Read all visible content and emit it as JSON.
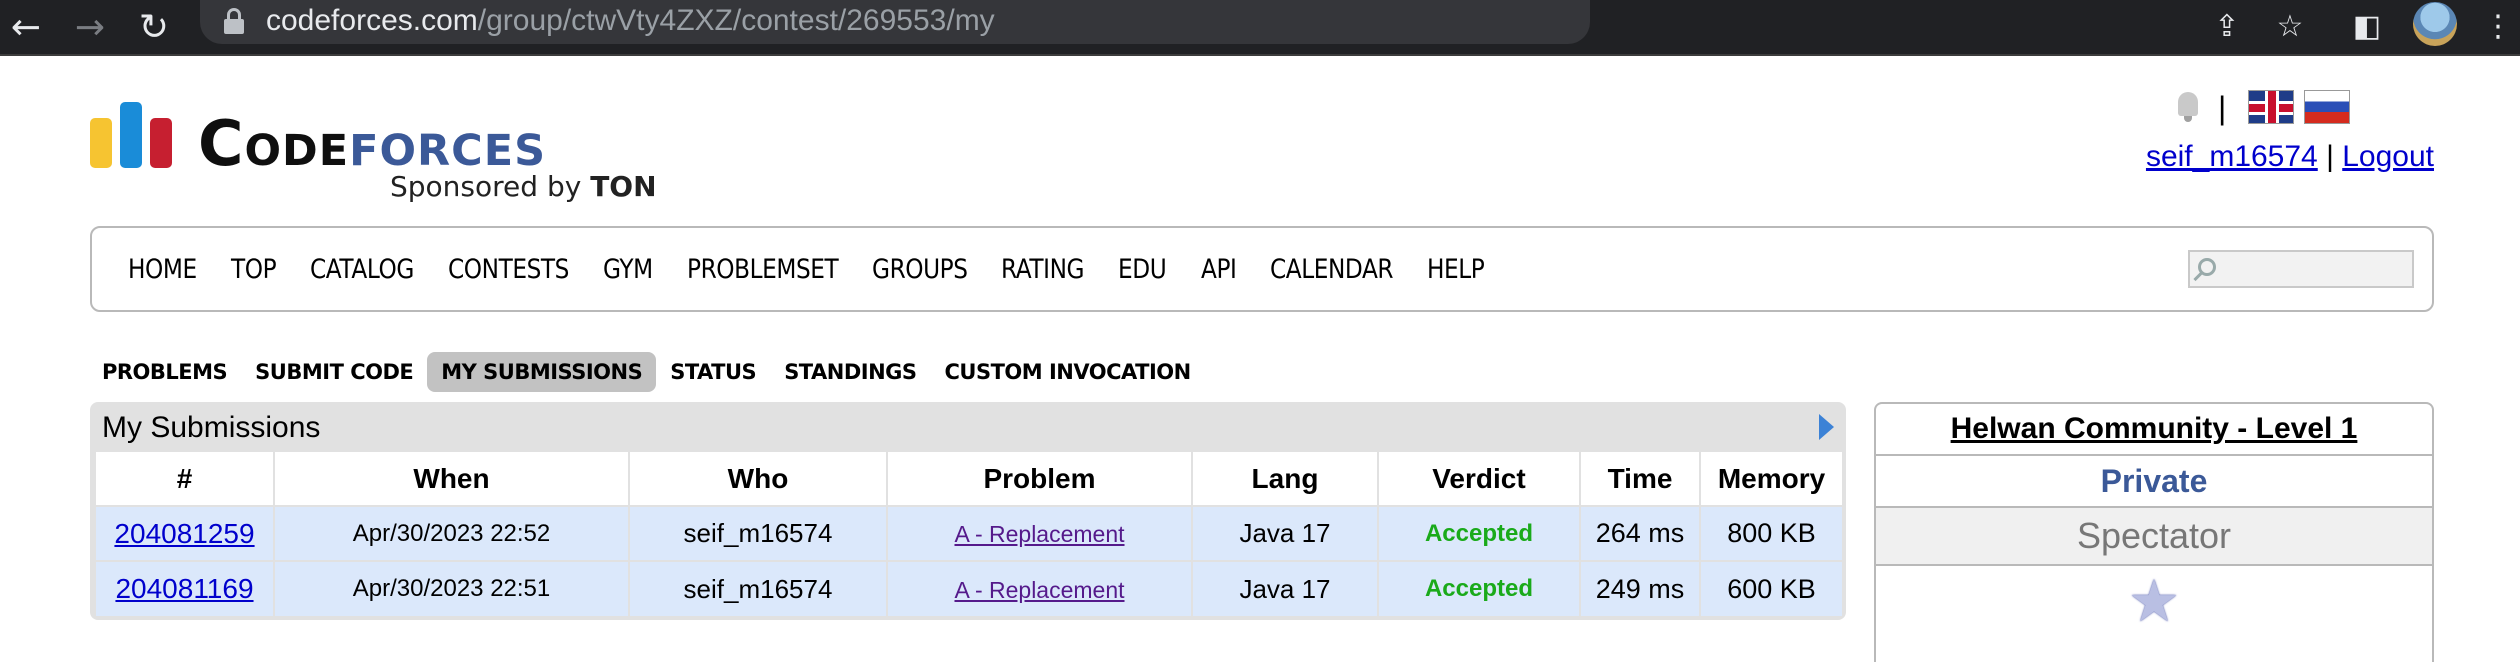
{
  "browser": {
    "url_domain": "codeforces.com",
    "url_path": "/group/ctwVty4ZXZ/contest/269553/my",
    "icons": [
      "back-arrow-icon",
      "forward-arrow-icon",
      "reload-icon",
      "lock-icon",
      "share-icon",
      "star-bookmark-icon",
      "side-panel-icon",
      "profile-avatar",
      "kebab-menu-icon"
    ]
  },
  "header": {
    "logo_word_code": "Code",
    "logo_word_forces": "forces",
    "sponsor_prefix": "Sponsored by",
    "sponsor_name": "TON",
    "separator": "|",
    "username": "seif_m16574",
    "logout": "Logout"
  },
  "menu": {
    "items": [
      "HOME",
      "TOP",
      "CATALOG",
      "CONTESTS",
      "GYM",
      "PROBLEMSET",
      "GROUPS",
      "RATING",
      "EDU",
      "API",
      "CALENDAR",
      "HELP"
    ]
  },
  "submenu": {
    "items": [
      "PROBLEMS",
      "SUBMIT CODE",
      "MY SUBMISSIONS",
      "STATUS",
      "STANDINGS",
      "CUSTOM INVOCATION"
    ],
    "active": "MY SUBMISSIONS"
  },
  "submissions": {
    "title": "My Submissions",
    "columns": [
      "#",
      "When",
      "Who",
      "Problem",
      "Lang",
      "Verdict",
      "Time",
      "Memory"
    ],
    "rows": [
      {
        "id": "204081259",
        "when": "Apr/30/2023 22:52",
        "who": "seif_m16574",
        "problem": "A - Replacement",
        "lang": "Java 17",
        "verdict": "Accepted",
        "time": "264 ms",
        "memory": "800 KB"
      },
      {
        "id": "204081169",
        "when": "Apr/30/2023 22:51",
        "who": "seif_m16574",
        "problem": "A - Replacement",
        "lang": "Java 17",
        "verdict": "Accepted",
        "time": "249 ms",
        "memory": "600 KB"
      }
    ]
  },
  "sidebar": {
    "contest_name": "Helwan Community - Level 1",
    "type": "Private",
    "role": "Spectator",
    "star": "★"
  },
  "colors": {
    "link": "#0000cc",
    "visited_link": "#551a8b",
    "accepted": "#1aaa1a",
    "row_bg": "#dbe8fb",
    "brand_blue": "#3b5998"
  }
}
